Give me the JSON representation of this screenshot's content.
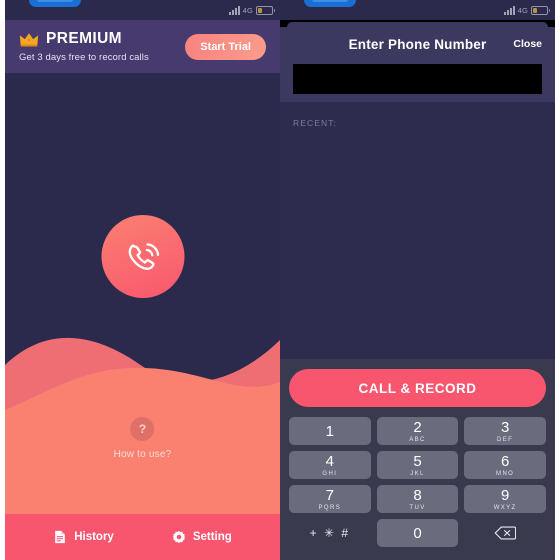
{
  "status_bar": {
    "network_label": "4G",
    "signal_icon": "signal-bars-icon",
    "battery_icon": "battery-icon",
    "pill_icon": "recording-pill-indicator"
  },
  "left_screen": {
    "premium": {
      "crown_icon": "crown-icon",
      "title": "PREMIUM",
      "subtitle": "Get 3 days free to record calls",
      "cta_label": "Start Trial"
    },
    "call_button_icon": "phone-call-icon",
    "help": {
      "icon_glyph": "?",
      "label": "How to use?"
    },
    "bottom_nav": [
      {
        "label": "History",
        "icon": "document-icon"
      },
      {
        "label": "Setting",
        "icon": "gear-icon"
      }
    ]
  },
  "right_screen": {
    "modal": {
      "title": "Enter Phone Number",
      "close_label": "Close",
      "phone_input_value": "",
      "phone_input_placeholder": ""
    },
    "recent_label": "RECENT:",
    "call_record_label": "CALL & RECORD",
    "keypad": [
      {
        "digit": "1",
        "letters": ""
      },
      {
        "digit": "2",
        "letters": "ABC"
      },
      {
        "digit": "3",
        "letters": "DEF"
      },
      {
        "digit": "4",
        "letters": "GHI"
      },
      {
        "digit": "5",
        "letters": "JKL"
      },
      {
        "digit": "6",
        "letters": "MNO"
      },
      {
        "digit": "7",
        "letters": "PQRS"
      },
      {
        "digit": "8",
        "letters": "TUV"
      },
      {
        "digit": "9",
        "letters": "WXYZ"
      }
    ],
    "symbol_key_label": "+ ✳ #",
    "zero_key": {
      "digit": "0",
      "letters": ""
    },
    "delete_icon": "backspace-icon"
  },
  "colors": {
    "dark_navy": "#2B2A4C",
    "premium_purple": "#463A6E",
    "accent_pink": "#F8566F",
    "wave_back": "#EE6E74",
    "wave_front": "#FA8170",
    "keypad_bg": "#3A3A4E",
    "key_grey": "#6B6B7E"
  }
}
